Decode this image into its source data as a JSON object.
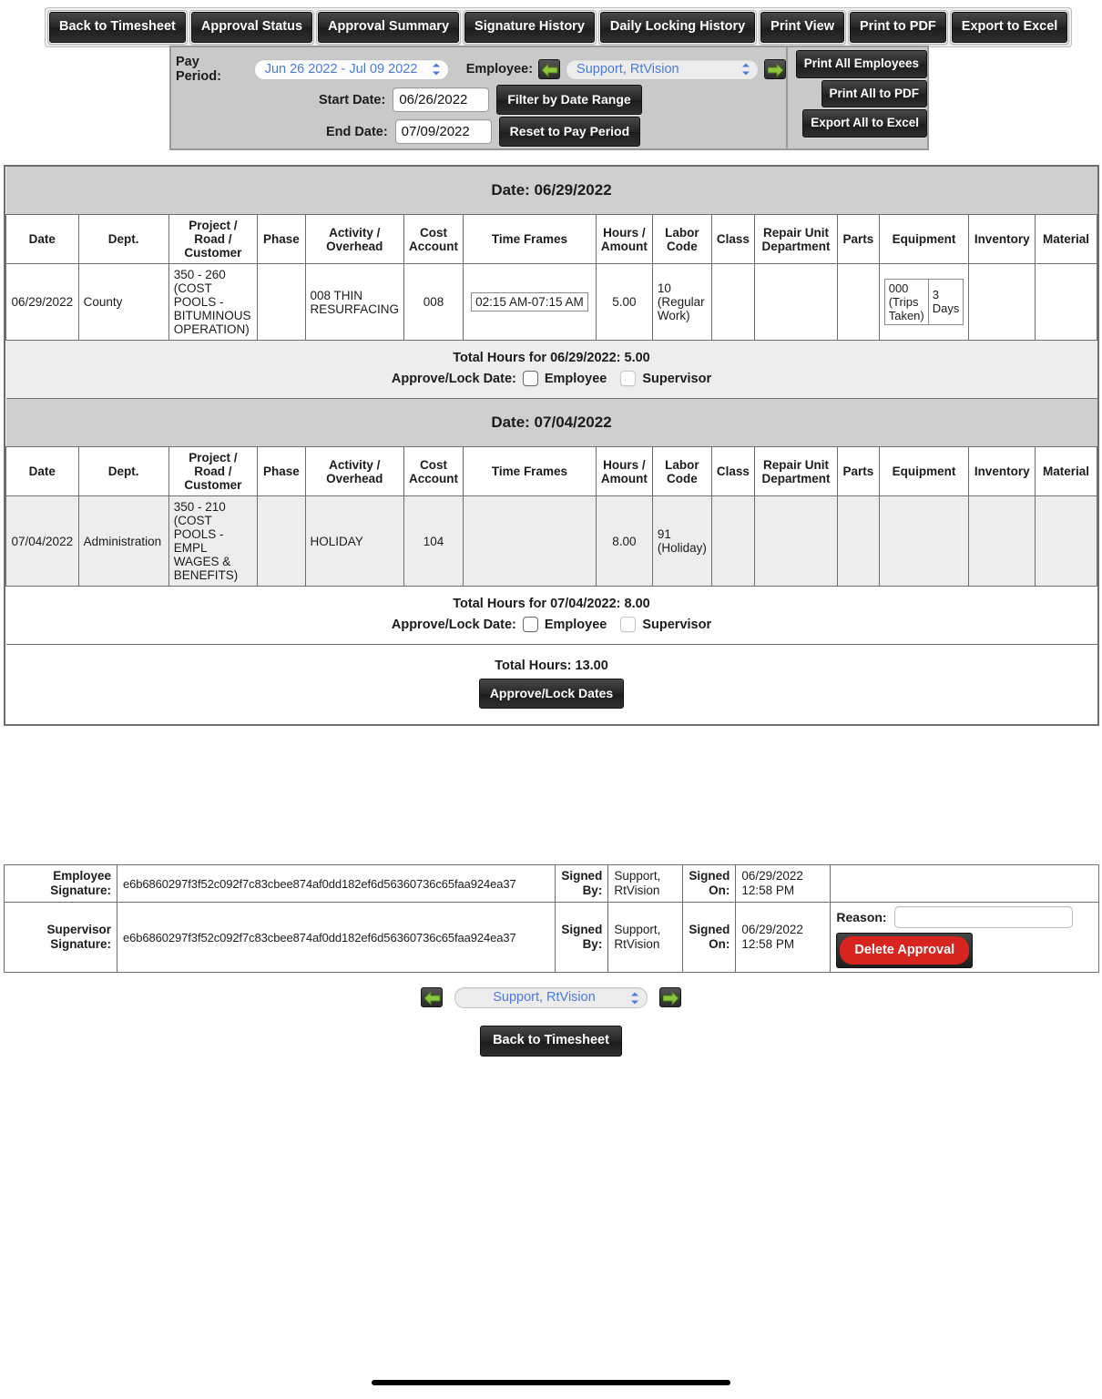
{
  "toolbar": {
    "buttons": [
      "Back to Timesheet",
      "Approval Status",
      "Approval Summary",
      "Signature History",
      "Daily Locking History",
      "Print View",
      "Print to PDF",
      "Export to Excel"
    ]
  },
  "filter_panel": {
    "pay_period_label": "Pay Period:",
    "pay_period_value": "Jun 26 2022 - Jul 09 2022",
    "employee_label": "Employee:",
    "employee_value": "Support, RtVision",
    "start_date_label": "Start Date:",
    "start_date_value": "06/26/2022",
    "end_date_label": "End Date:",
    "end_date_value": "07/09/2022",
    "filter_button": "Filter by Date Range",
    "reset_button": "Reset to Pay Period",
    "print_all_employees": "Print All Employees",
    "print_all_pdf": "Print All to PDF",
    "export_all_excel": "Export All to Excel"
  },
  "columns": [
    "Date",
    "Dept.",
    "Project /\nRoad /\nCustomer",
    "Phase",
    "Activity /\nOverhead",
    "Cost\nAccount",
    "Time Frames",
    "Hours /\nAmount",
    "Labor\nCode",
    "Class",
    "Repair Unit\nDepartment",
    "Parts",
    "Equipment",
    "Inventory",
    "Material"
  ],
  "column_lines": {
    "date": "Date",
    "dept": "Dept.",
    "project_l1": "Project /",
    "project_l2": "Road /",
    "project_l3": "Customer",
    "phase": "Phase",
    "activity_l1": "Activity /",
    "activity_l2": "Overhead",
    "cost_l1": "Cost",
    "cost_l2": "Account",
    "timeframes": "Time Frames",
    "hours_l1": "Hours /",
    "hours_l2": "Amount",
    "labor_l1": "Labor",
    "labor_l2": "Code",
    "class": "Class",
    "repair_l1": "Repair Unit",
    "repair_l2": "Department",
    "parts": "Parts",
    "equipment": "Equipment",
    "inventory": "Inventory",
    "material": "Material"
  },
  "day_groups": [
    {
      "banner": "Date: 06/29/2022",
      "row": {
        "date": "06/29/2022",
        "dept": "County",
        "project": "350 - 260 (COST POOLS - BITUMINOUS OPERATION)",
        "phase": "",
        "activity": "008 THIN RESURFACING",
        "cost_account": "008",
        "time_frames": "02:15 AM-07:15 AM",
        "hours": "5.00",
        "labor_code": "10 (Regular Work)",
        "class": "",
        "repair_unit_department": "",
        "parts": "",
        "equipment_code": "000 (Trips Taken)",
        "equipment_qty": "3 Days",
        "inventory": "",
        "material": ""
      },
      "total_text": "Total Hours for 06/29/2022: 5.00",
      "approve_label": "Approve/Lock Date:",
      "employee_checkbox_label": "Employee",
      "supervisor_checkbox_label": "Supervisor"
    },
    {
      "banner": "Date: 07/04/2022",
      "row": {
        "date": "07/04/2022",
        "dept": "Administration",
        "project": "350 - 210 (COST POOLS - EMPL WAGES & BENEFITS)",
        "phase": "",
        "activity": "HOLIDAY",
        "cost_account": "104",
        "time_frames": "",
        "hours": "8.00",
        "labor_code": "91 (Holiday)",
        "class": "",
        "repair_unit_department": "",
        "parts": "",
        "equipment_code": "",
        "equipment_qty": "",
        "inventory": "",
        "material": ""
      },
      "total_text": "Total Hours for 07/04/2022: 8.00",
      "approve_label": "Approve/Lock Date:",
      "employee_checkbox_label": "Employee",
      "supervisor_checkbox_label": "Supervisor"
    }
  ],
  "grand_total": {
    "text": "Total Hours: 13.00",
    "approve_button": "Approve/Lock Dates"
  },
  "signatures": {
    "employee": {
      "label_l1": "Employee",
      "label_l2": "Signature:",
      "hash": "e6b6860297f3f52c092f7c83cbee874af0dd182ef6d56360736c65faa924ea37",
      "signed_by_l1": "Signed",
      "signed_by_l2": "By:",
      "signed_by_name_l1": "Support,",
      "signed_by_name_l2": "RtVision",
      "signed_on_l1": "Signed",
      "signed_on_l2": "On:",
      "signed_on_date": "06/29/2022",
      "signed_on_time": "12:58 PM"
    },
    "supervisor": {
      "label_l1": "Supervisor",
      "label_l2": "Signature:",
      "hash": "e6b6860297f3f52c092f7c83cbee874af0dd182ef6d56360736c65faa924ea37",
      "signed_by_l1": "Signed",
      "signed_by_l2": "By:",
      "signed_by_name_l1": "Support,",
      "signed_by_name_l2": "RtVision",
      "signed_on_l1": "Signed",
      "signed_on_l2": "On:",
      "signed_on_date": "06/29/2022",
      "signed_on_time": "12:58 PM",
      "reason_label": "Reason:",
      "reason_value": "",
      "delete_button": "Delete Approval"
    }
  },
  "bottom_nav": {
    "employee_value": "Support, RtVision",
    "back_button": "Back to Timesheet"
  },
  "colors": {
    "accent_blue": "#4a7ae0",
    "danger_red": "#d8241f",
    "header_gray": "#cfcfcf",
    "panel_gray": "#c9c9c9",
    "arrow_green": "#7cb342"
  }
}
